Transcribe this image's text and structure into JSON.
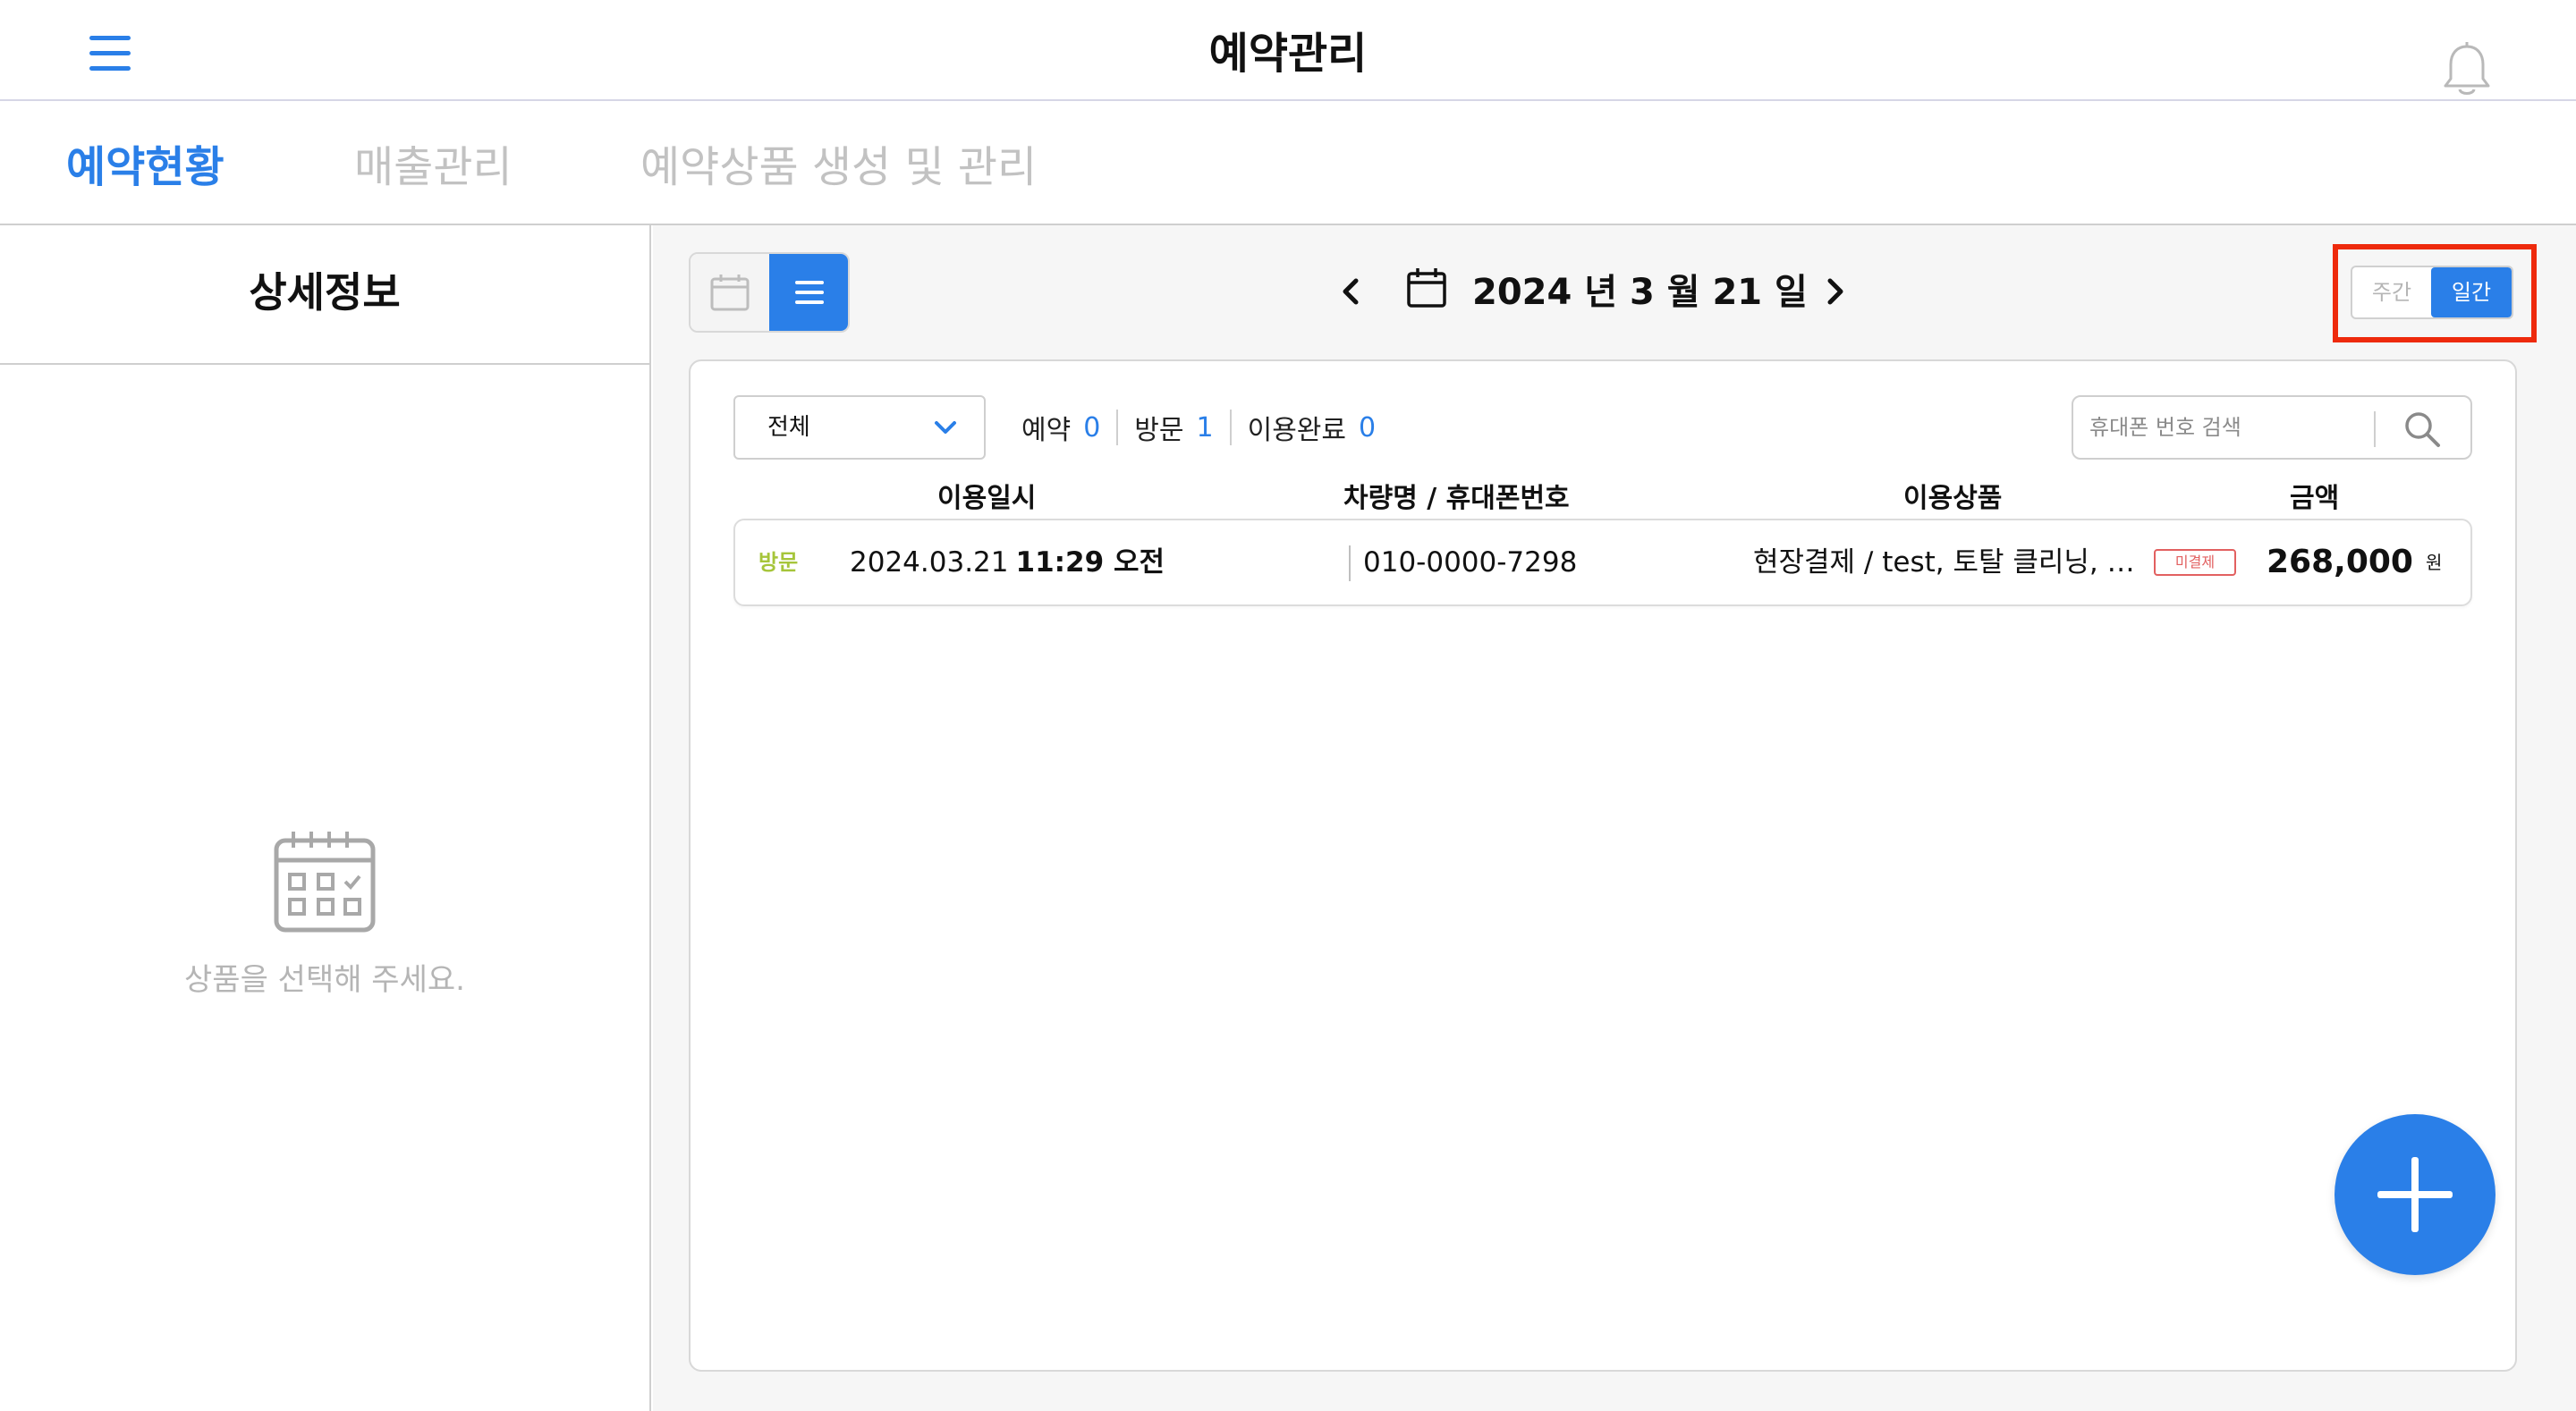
{
  "header": {
    "title": "예약관리"
  },
  "tabs": [
    {
      "label": "예약현황",
      "active": true
    },
    {
      "label": "매출관리",
      "active": false
    },
    {
      "label": "예약상품 생성 및 관리",
      "active": false
    }
  ],
  "left_panel": {
    "title": "상세정보",
    "empty_message": "상품을 선택해 주세요."
  },
  "date_nav": {
    "date_label": "2024 년  3 월  21 일"
  },
  "period_toggle": {
    "week_label": "주간",
    "day_label": "일간",
    "selected": "일간"
  },
  "filter": {
    "selected": "전체"
  },
  "counts": [
    {
      "label": "예약",
      "value": "0"
    },
    {
      "label": "방문",
      "value": "1"
    },
    {
      "label": "이용완료",
      "value": "0"
    }
  ],
  "search": {
    "placeholder": "휴대폰 번호 검색",
    "value": ""
  },
  "table": {
    "columns": [
      "이용일시",
      "차량명 / 휴대폰번호",
      "이용상품",
      "금액"
    ],
    "rows": [
      {
        "status": "방문",
        "date": "2024.03.21",
        "time": "11:29 오전",
        "phone": "010-0000-7298",
        "product": "현장결제 / test, 토탈 클리닝, 디테일링",
        "payment_badge": "미결제",
        "amount": "268,000",
        "unit": "원"
      }
    ]
  },
  "colors": {
    "accent": "#2a7fe8",
    "status_visit": "#a6c53a",
    "unpaid_badge": "#e26060",
    "highlight": "#ee2a0c"
  },
  "icons": {
    "menu": "hamburger-icon",
    "notification": "bell-icon",
    "calendar_view": "calendar-icon",
    "list_view": "list-icon",
    "date_calendar": "calendar-icon",
    "search": "search-icon",
    "add": "plus-icon",
    "empty_state": "calendar-check-icon"
  }
}
